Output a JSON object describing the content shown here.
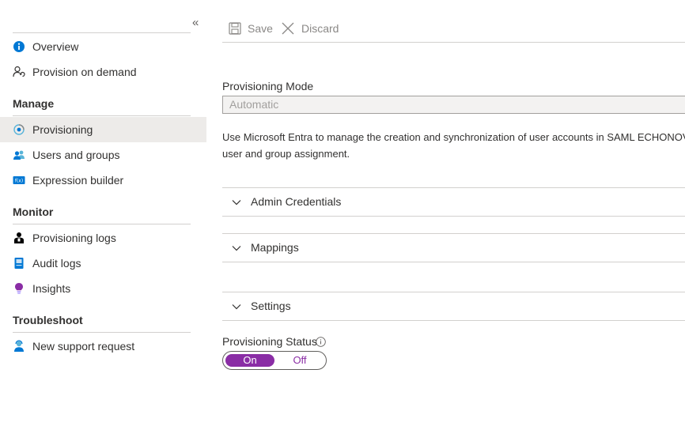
{
  "sidebar": {
    "collapse_glyph": "«",
    "items": [
      {
        "label": "Overview",
        "icon": "info-icon"
      },
      {
        "label": "Provision on demand",
        "icon": "provision-on-demand-icon"
      }
    ],
    "sections": [
      {
        "title": "Manage",
        "items": [
          {
            "label": "Provisioning",
            "icon": "provisioning-icon",
            "selected": true
          },
          {
            "label": "Users and groups",
            "icon": "users-groups-icon"
          },
          {
            "label": "Expression builder",
            "icon": "expression-builder-icon"
          }
        ]
      },
      {
        "title": "Monitor",
        "items": [
          {
            "label": "Provisioning logs",
            "icon": "provisioning-logs-icon"
          },
          {
            "label": "Audit logs",
            "icon": "audit-logs-icon"
          },
          {
            "label": "Insights",
            "icon": "insights-icon"
          }
        ]
      },
      {
        "title": "Troubleshoot",
        "items": [
          {
            "label": "New support request",
            "icon": "support-request-icon"
          }
        ]
      }
    ]
  },
  "toolbar": {
    "save_label": "Save",
    "discard_label": "Discard"
  },
  "main": {
    "provisioning_mode_label": "Provisioning Mode",
    "provisioning_mode_value": "Automatic",
    "description_line1": "Use Microsoft Entra to manage the creation and synchronization of user accounts in SAML ECHONOVU",
    "description_line2": "user and group assignment.",
    "accordions": [
      {
        "label": "Admin Credentials"
      },
      {
        "label": "Mappings"
      },
      {
        "label": "Settings"
      }
    ],
    "status_label": "Provisioning Status",
    "status_on": "On",
    "status_off": "Off",
    "status_value": "On"
  },
  "colors": {
    "accent": "#8a2da5",
    "selected_bg": "#edebe9",
    "divider": "#d2d0ce",
    "info_blue": "#0078d4"
  }
}
